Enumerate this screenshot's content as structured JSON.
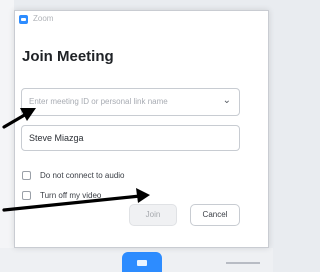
{
  "window": {
    "title": "Zoom",
    "heading": "Join Meeting"
  },
  "meeting_id": {
    "placeholder": "Enter meeting ID or personal link name"
  },
  "name_field": {
    "value": "Steve Miazga"
  },
  "options": [
    {
      "label": "Do not connect to audio",
      "checked": false
    },
    {
      "label": "Turn off my video",
      "checked": false
    }
  ],
  "buttons": {
    "join": "Join",
    "cancel": "Cancel"
  },
  "colors": {
    "accent": "#2d8cff",
    "arrow": "#000000"
  }
}
